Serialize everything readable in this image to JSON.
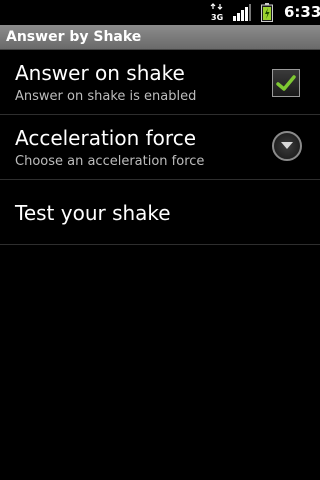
{
  "status_bar": {
    "network_label": "3G",
    "time": "6:33",
    "icons": [
      "3g-data-icon",
      "signal-icon",
      "battery-icon"
    ]
  },
  "title_bar": {
    "title": "Answer by Shake"
  },
  "preferences": [
    {
      "title": "Answer on shake",
      "summary": "Answer on shake is enabled",
      "widget": "checkbox",
      "checked": true
    },
    {
      "title": "Acceleration force",
      "summary": "Choose an acceleration force",
      "widget": "dropdown"
    },
    {
      "title": "Test your shake",
      "summary": ""
    }
  ],
  "colors": {
    "background": "#000000",
    "title_bar": "#7b7b7b",
    "check_accent": "#7ec832",
    "summary_text": "#bdbdbd",
    "battery_green": "#9bd22e"
  }
}
